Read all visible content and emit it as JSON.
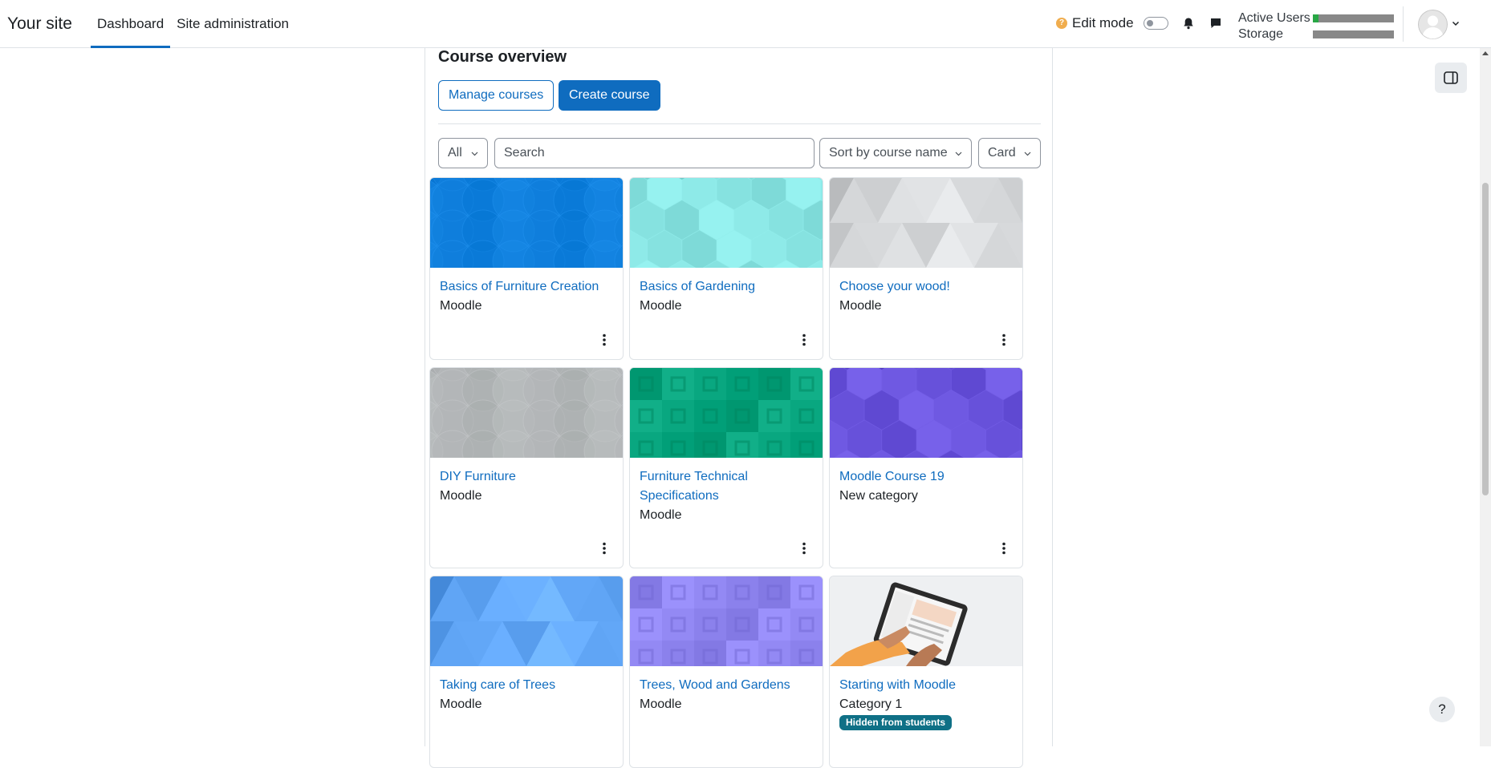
{
  "navbar": {
    "brand": "Your site",
    "links": [
      {
        "label": "Dashboard",
        "active": true
      },
      {
        "label": "Site administration",
        "active": false
      }
    ],
    "edit_mode_label": "Edit mode",
    "quota": [
      {
        "label": "Active Users",
        "fill_fraction": 0.07
      },
      {
        "label": "Storage",
        "fill_fraction": 0.0
      }
    ]
  },
  "main": {
    "title": "Course overview",
    "manage_label": "Manage courses",
    "create_label": "Create course",
    "filter_label": "All",
    "search_placeholder": "Search",
    "sort_label": "Sort by course name",
    "view_label": "Card"
  },
  "courses": [
    {
      "name": "Basics of Furniture Creation",
      "category": "Moodle",
      "pattern": "circles",
      "color": "#0f7fdc"
    },
    {
      "name": "Basics of Gardening",
      "category": "Moodle",
      "pattern": "hexagons",
      "color": "#8ae6e4"
    },
    {
      "name": "Choose your wood!",
      "category": "Moodle",
      "pattern": "triangles",
      "color": "#dfe1e3"
    },
    {
      "name": "DIY Furniture",
      "category": "Moodle",
      "pattern": "circles",
      "color": "#b3b6b8"
    },
    {
      "name": "Furniture Technical Specifications",
      "category": "Moodle",
      "pattern": "squares",
      "color": "#05a37c"
    },
    {
      "name": "Moodle Course 19",
      "category": "New category",
      "pattern": "hexagons",
      "color": "#6b55de"
    },
    {
      "name": "Taking care of Trees",
      "category": "Moodle",
      "pattern": "triangles",
      "color": "#6aafff"
    },
    {
      "name": "Trees, Wood and Gardens",
      "category": "Moodle",
      "pattern": "squares",
      "color": "#8f85f0"
    },
    {
      "name": "Starting with Moodle",
      "category": "Category 1",
      "pattern": "photo",
      "color": "#e8eaec",
      "badge": "Hidden from students"
    }
  ],
  "help_label": "?"
}
